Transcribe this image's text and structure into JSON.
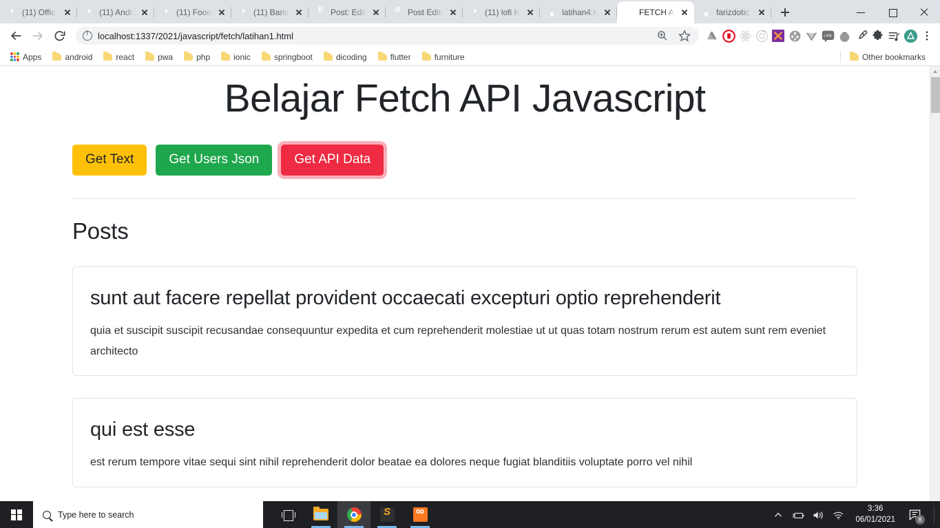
{
  "browser": {
    "tabs": [
      {
        "title": "(11) Offic",
        "favicon": "youtube-icon",
        "active": false
      },
      {
        "title": "(11) Andr",
        "favicon": "youtube-icon",
        "active": false
      },
      {
        "title": "(11) Food",
        "favicon": "youtube-icon",
        "active": false
      },
      {
        "title": "(11) Baris",
        "favicon": "youtube-icon",
        "active": false
      },
      {
        "title": "Post: Edit",
        "favicon": "blogger-icon",
        "active": false
      },
      {
        "title": "Post Edito",
        "favicon": "blogger-icon",
        "active": false
      },
      {
        "title": "(11) lofi h",
        "favicon": "youtube-icon",
        "active": false
      },
      {
        "title": "latihan4.h",
        "favicon": "github-icon",
        "active": false
      },
      {
        "title": "FETCH AP",
        "favicon": "xampp-icon",
        "active": true
      },
      {
        "title": "farizdotic",
        "favicon": "github-icon",
        "active": false
      }
    ],
    "new_tab_label": "New Tab",
    "window_controls": {
      "minimize": "Minimize",
      "maximize": "Maximize",
      "close": "Close"
    },
    "toolbar": {
      "back_label": "Back",
      "forward_label": "Forward",
      "reload_label": "Reload",
      "url": "localhost:1337/2021/javascript/fetch/latihan1.html",
      "zoom_label": "Zoom",
      "bookmark_label": "Bookmark this tab",
      "extensions": [
        "drive-icon",
        "adblock-icon",
        "react-devtools-icon",
        "lighthouse-icon",
        "xmind-icon",
        "video-download-icon",
        "vue-devtools-icon",
        "line-icon",
        "tomato-timer-icon",
        "colorpicker-icon",
        "puzzle-icon",
        "playlist-icon"
      ],
      "profile_label": "Profile",
      "menu_label": "Customize and control Google Chrome"
    },
    "bookmarks": {
      "apps_label": "Apps",
      "items": [
        "android",
        "react",
        "pwa",
        "php",
        "ionic",
        "springboot",
        "dicoding",
        "flutter",
        "furniture"
      ],
      "other_label": "Other bookmarks"
    }
  },
  "page": {
    "title": "Belajar Fetch API Javascript",
    "buttons": [
      {
        "label": "Get Text",
        "style": "warning",
        "focused": false
      },
      {
        "label": "Get Users Json",
        "style": "success",
        "focused": false
      },
      {
        "label": "Get API Data",
        "style": "danger",
        "focused": true
      }
    ],
    "section_heading": "Posts",
    "posts": [
      {
        "title": "sunt aut facere repellat provident occaecati excepturi optio reprehenderit",
        "body": "quia et suscipit suscipit recusandae consequuntur expedita et cum reprehenderit molestiae ut ut quas totam nostrum rerum est autem sunt rem eveniet architecto"
      },
      {
        "title": "qui est esse",
        "body": "est rerum tempore vitae sequi sint nihil reprehenderit dolor beatae ea dolores neque fugiat blanditiis voluptate porro vel nihil"
      }
    ],
    "colors": {
      "warning": "#ffc107",
      "success": "#1ea74c",
      "danger": "#ee2b42",
      "text": "#212529",
      "card_border": "#e2e2e2"
    }
  },
  "taskbar": {
    "start_label": "Start",
    "search_placeholder": "Type here to search",
    "task_view_label": "Task View",
    "apps": [
      {
        "name": "file-explorer-icon",
        "running": true,
        "active": false
      },
      {
        "name": "chrome-icon",
        "running": true,
        "active": true
      },
      {
        "name": "sublime-text-icon",
        "running": true,
        "active": false
      },
      {
        "name": "xampp-icon",
        "running": true,
        "active": false
      }
    ],
    "tray": {
      "show_hidden_label": "Show hidden icons",
      "battery_label": "Battery",
      "volume_label": "Volume",
      "network_label": "Network",
      "time": "3:36",
      "date": "06/01/2021",
      "notification_count": "8"
    }
  }
}
